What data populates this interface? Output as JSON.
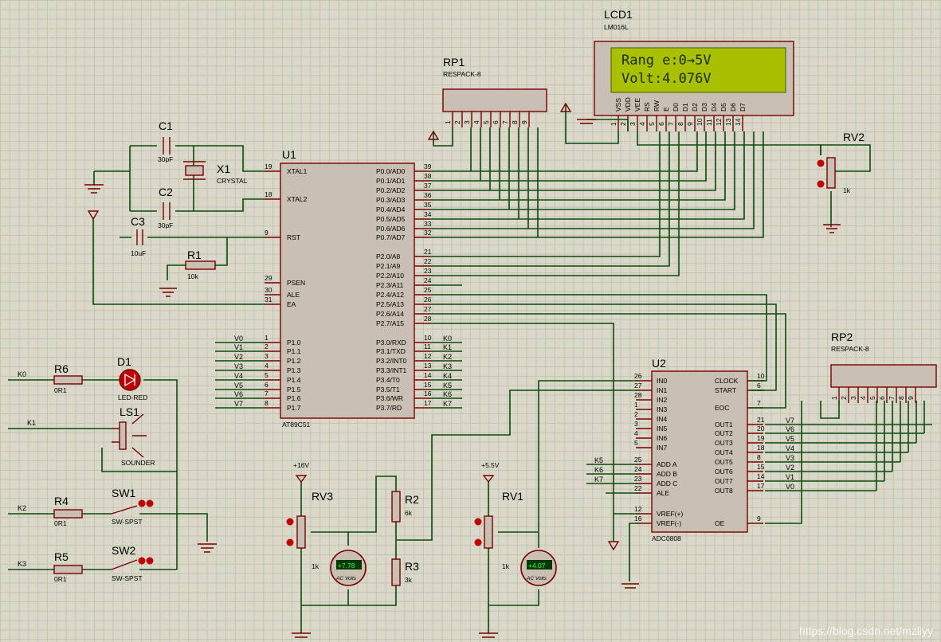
{
  "lcd": {
    "ref": "LCD1",
    "model": "LM016L",
    "line1": "Rang e:0→5V",
    "line2": "Volt:4.076V",
    "pins": [
      "VSS",
      "VDD",
      "VEE",
      "RS",
      "RW",
      "E",
      "D0",
      "D1",
      "D2",
      "D3",
      "D4",
      "D5",
      "D6",
      "D7"
    ],
    "pin_nums": [
      "1",
      "2",
      "3",
      "4",
      "5",
      "6",
      "7",
      "8",
      "9",
      "10",
      "11",
      "12",
      "13",
      "14"
    ]
  },
  "rp1": {
    "ref": "RP1",
    "model": "RESPACK-8",
    "pins": [
      "1",
      "2",
      "3",
      "4",
      "5",
      "6",
      "7",
      "8",
      "9"
    ]
  },
  "rp2": {
    "ref": "RP2",
    "model": "RESPACK-8",
    "pins": [
      "1",
      "2",
      "3",
      "4",
      "5",
      "6",
      "7",
      "8",
      "9"
    ]
  },
  "u1": {
    "ref": "U1",
    "model": "AT89C51",
    "left": [
      [
        "XTAL1",
        "19"
      ],
      [
        "XTAL2",
        "18"
      ],
      [
        "RST",
        "9"
      ],
      [
        "PSEN",
        "29"
      ],
      [
        "ALE",
        "30"
      ],
      [
        "EA",
        "31"
      ],
      [
        "P1.0",
        "1"
      ],
      [
        "P1.1",
        "2"
      ],
      [
        "P1.2",
        "3"
      ],
      [
        "P1.3",
        "4"
      ],
      [
        "P1.4",
        "5"
      ],
      [
        "P1.5",
        "6"
      ],
      [
        "P1.6",
        "7"
      ],
      [
        "P1.7",
        "8"
      ]
    ],
    "right": [
      [
        "P0.0/AD0",
        "39"
      ],
      [
        "P0.1/AD1",
        "38"
      ],
      [
        "P0.2/AD2",
        "37"
      ],
      [
        "P0.3/AD3",
        "36"
      ],
      [
        "P0.4/AD4",
        "35"
      ],
      [
        "P0.5/AD5",
        "34"
      ],
      [
        "P0.6/AD6",
        "33"
      ],
      [
        "P0.7/AD7",
        "32"
      ],
      [
        "P2.0/A8",
        "21"
      ],
      [
        "P2.1/A9",
        "22"
      ],
      [
        "P2.2/A10",
        "23"
      ],
      [
        "P2.3/A11",
        "24"
      ],
      [
        "P2.4/A12",
        "25"
      ],
      [
        "P2.5/A13",
        "26"
      ],
      [
        "P2.6/A14",
        "27"
      ],
      [
        "P2.7/A15",
        "28"
      ],
      [
        "P3.0/RXD",
        "10"
      ],
      [
        "P3.1/TXD",
        "11"
      ],
      [
        "P3.2/INT0",
        "12"
      ],
      [
        "P3.3/INT1",
        "13"
      ],
      [
        "P3.4/T0",
        "14"
      ],
      [
        "P3.5/T1",
        "15"
      ],
      [
        "P3.6/WR",
        "16"
      ],
      [
        "P3.7/RD",
        "17"
      ]
    ],
    "p1_nets": [
      "V0",
      "V1",
      "V2",
      "V3",
      "V4",
      "V5",
      "V6",
      "V7"
    ],
    "p3_nets": [
      "K0",
      "K1",
      "K2",
      "K3",
      "K4",
      "K5",
      "K6",
      "K7"
    ]
  },
  "u2": {
    "ref": "U2",
    "model": "ADC0808",
    "left": [
      [
        "IN0",
        "26"
      ],
      [
        "IN1",
        "27"
      ],
      [
        "IN2",
        "28"
      ],
      [
        "IN3",
        "1"
      ],
      [
        "IN4",
        "2"
      ],
      [
        "IN5",
        "3"
      ],
      [
        "IN6",
        "4"
      ],
      [
        "IN7",
        "5"
      ],
      [
        "ADD A",
        "25"
      ],
      [
        "ADD B",
        "24"
      ],
      [
        "ADD C",
        "23"
      ],
      [
        "ALE",
        "22"
      ],
      [
        "VREF(+)",
        "12"
      ],
      [
        "VREF(-)",
        "16"
      ]
    ],
    "right": [
      [
        "CLOCK",
        "10"
      ],
      [
        "START",
        "6"
      ],
      [
        "EOC",
        "7"
      ],
      [
        "OUT1",
        "21"
      ],
      [
        "OUT2",
        "20"
      ],
      [
        "OUT3",
        "19"
      ],
      [
        "OUT4",
        "18"
      ],
      [
        "OUT5",
        "8"
      ],
      [
        "OUT6",
        "15"
      ],
      [
        "OUT7",
        "14"
      ],
      [
        "OUT8",
        "17"
      ],
      [
        "OE",
        "9"
      ]
    ],
    "addr_nets": [
      "K5",
      "K6",
      "K7"
    ],
    "out_nets": [
      "V7",
      "V6",
      "V5",
      "V4",
      "V3",
      "V2",
      "V1",
      "V0"
    ]
  },
  "c1": {
    "ref": "C1",
    "value": "30pF"
  },
  "c2": {
    "ref": "C2",
    "value": "30pF"
  },
  "c3": {
    "ref": "C3",
    "value": "10uF"
  },
  "x1": {
    "ref": "X1",
    "model": "CRYSTAL"
  },
  "r1": {
    "ref": "R1",
    "value": "10k"
  },
  "r2": {
    "ref": "R2",
    "value": "6k"
  },
  "r3": {
    "ref": "R3",
    "value": "3k"
  },
  "r4": {
    "ref": "R4",
    "value": "0R1"
  },
  "r5": {
    "ref": "R5",
    "value": "0R1"
  },
  "r6": {
    "ref": "R6",
    "value": "0R1"
  },
  "d1": {
    "ref": "D1",
    "model": "LED-RED"
  },
  "ls1": {
    "ref": "LS1",
    "model": "SOUNDER"
  },
  "sw1": {
    "ref": "SW1",
    "model": "SW-SPST"
  },
  "sw2": {
    "ref": "SW2",
    "model": "SW-SPST"
  },
  "rv1": {
    "ref": "RV1",
    "value": "1k",
    "supply": "+5.5V"
  },
  "rv2": {
    "ref": "RV2",
    "value": "1k"
  },
  "rv3": {
    "ref": "RV3",
    "value": "1k",
    "supply": "+16V"
  },
  "voltmeter1": {
    "reading": "+7.78",
    "unit": "AC Volts"
  },
  "voltmeter2": {
    "reading": "+4.07",
    "unit": "AC Volts"
  },
  "nets": {
    "k0": "K0",
    "k1": "K1",
    "k2": "K2",
    "k3": "K3"
  },
  "watermark": "https://blog.csdn.net/mzliyy"
}
